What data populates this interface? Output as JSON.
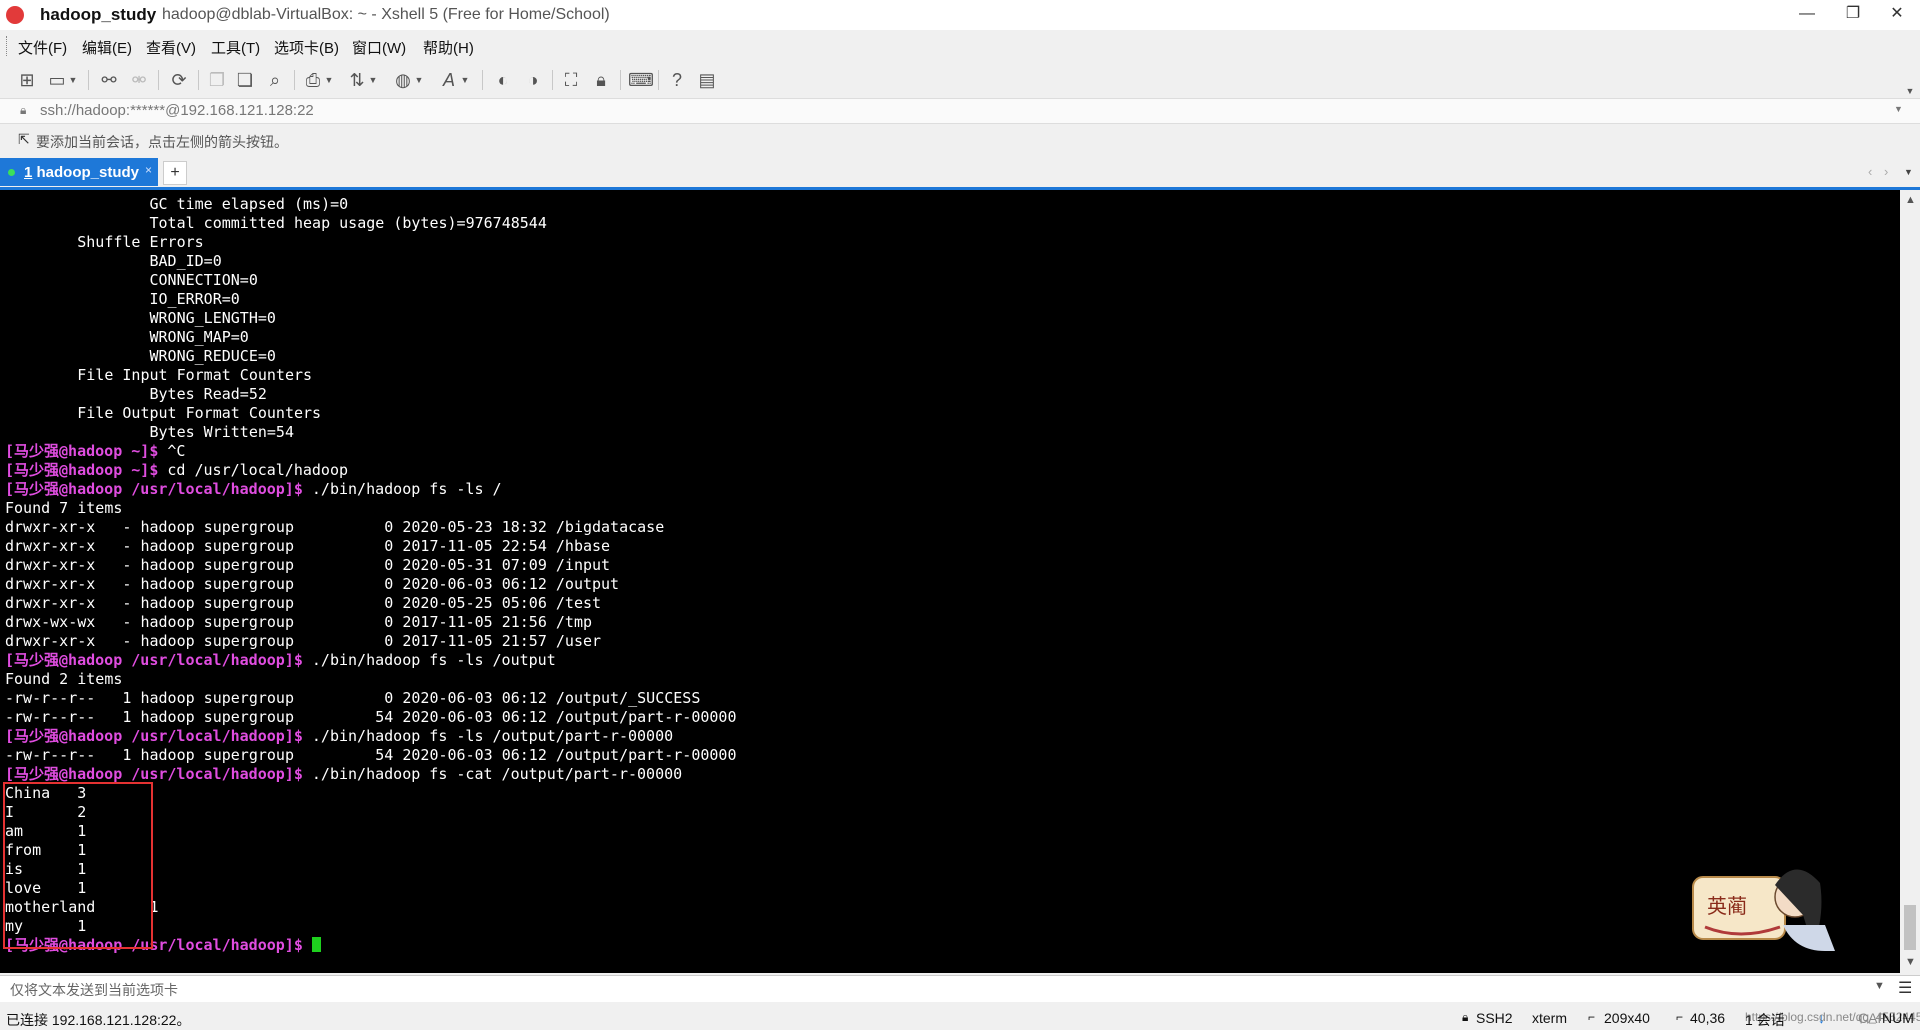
{
  "window": {
    "title_bold": "hadoop_study",
    "title_rest": "hadoop@dblab-VirtualBox: ~ - Xshell 5 (Free for Home/School)",
    "minimize": "—",
    "maximize": "❐",
    "close": "✕"
  },
  "menu": [
    "文件(F)",
    "编辑(E)",
    "查看(V)",
    "工具(T)",
    "选项卡(B)",
    "窗口(W)",
    "帮助(H)"
  ],
  "address": {
    "url": "ssh://hadoop:******@192.168.121.128:22"
  },
  "hint": "要添加当前会话，点击左侧的箭头按钮。",
  "tabs": [
    {
      "number": "1",
      "label": "hadoop_study",
      "close": "×"
    }
  ],
  "add_tab": "+",
  "terminal": {
    "lines": [
      {
        "text": "                GC time elapsed (ms)=0"
      },
      {
        "text": "                Total committed heap usage (bytes)=976748544"
      },
      {
        "text": "        Shuffle Errors"
      },
      {
        "text": "                BAD_ID=0"
      },
      {
        "text": "                CONNECTION=0"
      },
      {
        "text": "                IO_ERROR=0"
      },
      {
        "text": "                WRONG_LENGTH=0"
      },
      {
        "text": "                WRONG_MAP=0"
      },
      {
        "text": "                WRONG_REDUCE=0"
      },
      {
        "text": "        File Input Format Counters "
      },
      {
        "text": "                Bytes Read=52"
      },
      {
        "text": "        File Output Format Counters "
      },
      {
        "text": "                Bytes Written=54"
      },
      {
        "prompt": "[马少强@hadoop ~]$",
        "text": " ^C"
      },
      {
        "prompt": "[马少强@hadoop ~]$",
        "text": " cd /usr/local/hadoop"
      },
      {
        "prompt": "[马少强@hadoop /usr/local/hadoop]$",
        "text": " ./bin/hadoop fs -ls /"
      },
      {
        "text": "Found 7 items"
      },
      {
        "text": "drwxr-xr-x   - hadoop supergroup          0 2020-05-23 18:32 /bigdatacase"
      },
      {
        "text": "drwxr-xr-x   - hadoop supergroup          0 2017-11-05 22:54 /hbase"
      },
      {
        "text": "drwxr-xr-x   - hadoop supergroup          0 2020-05-31 07:09 /input"
      },
      {
        "text": "drwxr-xr-x   - hadoop supergroup          0 2020-06-03 06:12 /output"
      },
      {
        "text": "drwxr-xr-x   - hadoop supergroup          0 2020-05-25 05:06 /test"
      },
      {
        "text": "drwx-wx-wx   - hadoop supergroup          0 2017-11-05 21:56 /tmp"
      },
      {
        "text": "drwxr-xr-x   - hadoop supergroup          0 2017-11-05 21:57 /user"
      },
      {
        "prompt": "[马少强@hadoop /usr/local/hadoop]$",
        "text": " ./bin/hadoop fs -ls /output"
      },
      {
        "text": "Found 2 items"
      },
      {
        "text": "-rw-r--r--   1 hadoop supergroup          0 2020-06-03 06:12 /output/_SUCCESS"
      },
      {
        "text": "-rw-r--r--   1 hadoop supergroup         54 2020-06-03 06:12 /output/part-r-00000"
      },
      {
        "prompt": "[马少强@hadoop /usr/local/hadoop]$",
        "text": " ./bin/hadoop fs -ls /output/part-r-00000"
      },
      {
        "text": "-rw-r--r--   1 hadoop supergroup         54 2020-06-03 06:12 /output/part-r-00000"
      },
      {
        "prompt": "[马少强@hadoop /usr/local/hadoop]$",
        "text": " ./bin/hadoop fs -cat /output/part-r-00000"
      },
      {
        "text": "China   3"
      },
      {
        "text": "I       2"
      },
      {
        "text": "am      1"
      },
      {
        "text": "from    1"
      },
      {
        "text": "is      1"
      },
      {
        "text": "love    1"
      },
      {
        "text": "motherland      1"
      },
      {
        "text": "my      1"
      },
      {
        "prompt": "[马少强@hadoop /usr/local/hadoop]$",
        "text": " ",
        "cursor": true
      }
    ]
  },
  "sticker": {
    "text": "英蔺"
  },
  "compose": {
    "placeholder": "仅将文本发送到当前选项卡"
  },
  "status": {
    "connection": "已连接 192.168.121.128:22。",
    "protocol": "SSH2",
    "term": "xterm",
    "size": "209x40",
    "cursor_pos": "40,36",
    "sessions": "1 会话",
    "caps": "CAP",
    "num": "NUM",
    "watermark": "https://blog.csdn.net/qq_45524450"
  },
  "colors": {
    "tab_active": "#1e78d8",
    "prompt": "#e04de0",
    "cursor": "#1ed01e",
    "highlight_box": "#e53232"
  }
}
